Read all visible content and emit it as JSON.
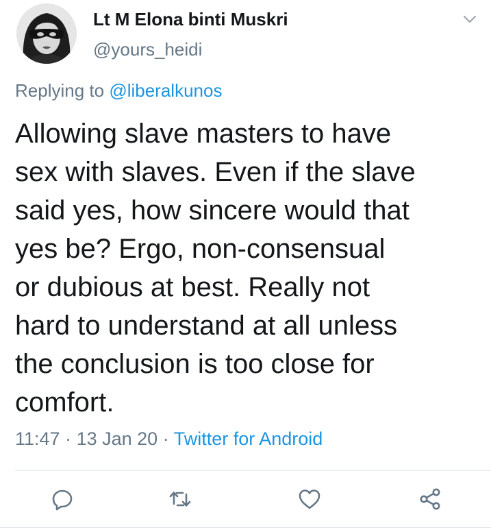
{
  "tweet": {
    "author": {
      "display_name": "Lt M Elona binti Muskri",
      "handle": "@yours_heidi"
    },
    "reply": {
      "prefix": "Replying to ",
      "mention": "@liberalkunos"
    },
    "text_lines": [
      "Allowing slave masters to have",
      "sex with slaves. Even if the slave",
      "said yes, how sincere would that",
      "yes be? Ergo, non-consensual",
      "or dubious at best. Really not",
      "hard to understand at all unless",
      "the conclusion is too close for",
      "comfort."
    ],
    "meta": {
      "time": "11:47",
      "separator": " · ",
      "date": "13 Jan 20",
      "source": "Twitter for Android"
    },
    "actions": [
      {
        "name": "reply",
        "icon": "reply-icon"
      },
      {
        "name": "retweet",
        "icon": "retweet-icon"
      },
      {
        "name": "like",
        "icon": "heart-icon"
      },
      {
        "name": "share",
        "icon": "share-icon"
      }
    ],
    "colors": {
      "text": "#14171a",
      "secondary": "#657786",
      "link": "#1b95e0",
      "divider": "#e1e8ed"
    }
  }
}
